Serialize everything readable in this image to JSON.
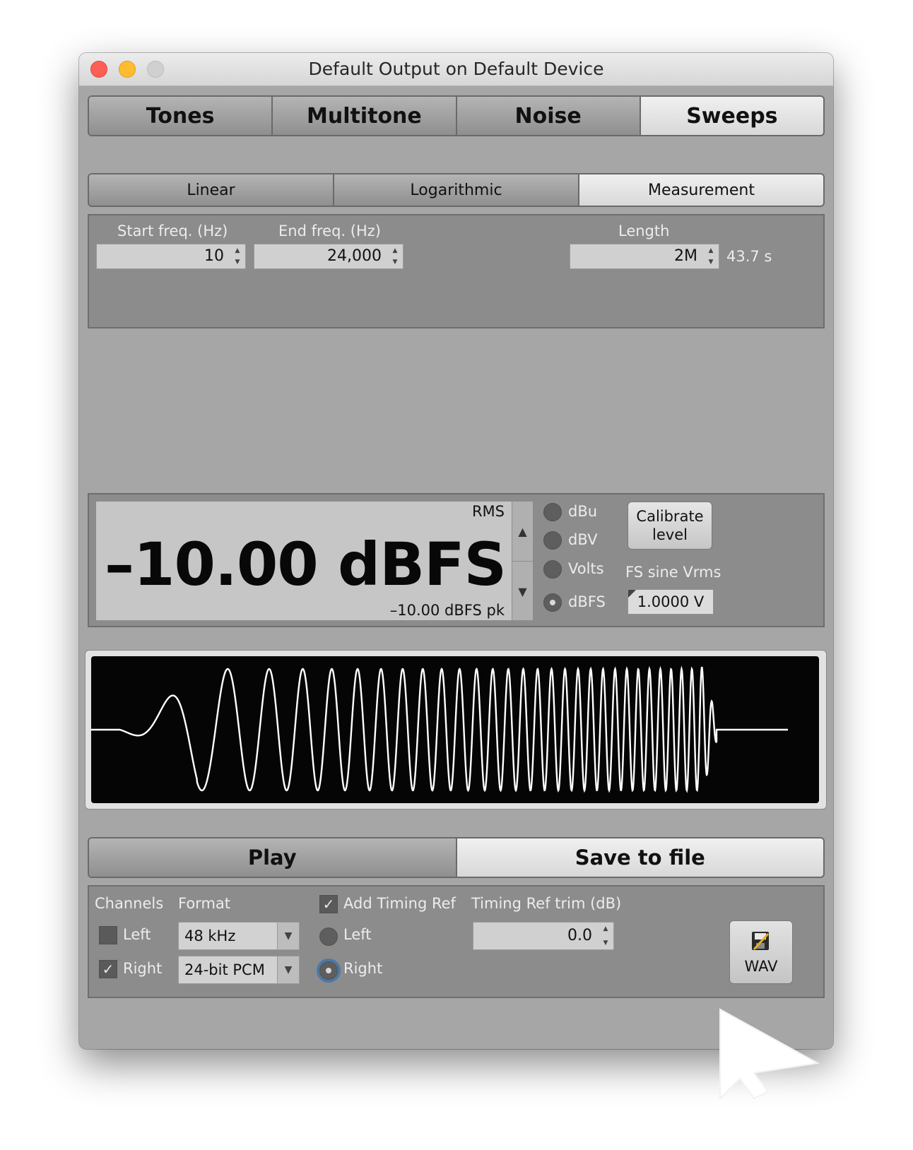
{
  "window": {
    "title": "Default Output on Default Device"
  },
  "main_tabs": [
    "Tones",
    "Multitone",
    "Noise",
    "Sweeps"
  ],
  "main_tab_active": "Sweeps",
  "sub_tabs": [
    "Linear",
    "Logarithmic",
    "Measurement"
  ],
  "sub_tab_active": "Measurement",
  "sweep": {
    "start_label": "Start freq. (Hz)",
    "start_value": "10",
    "end_label": "End freq. (Hz)",
    "end_value": "24,000",
    "length_label": "Length",
    "length_value": "2M",
    "length_seconds": "43.7 s"
  },
  "level": {
    "rms_label": "RMS",
    "value": "–10.00 dBFS",
    "peak": "–10.00 dBFS pk",
    "units": [
      "dBu",
      "dBV",
      "Volts",
      "dBFS"
    ],
    "unit_selected": "dBFS",
    "calibrate_line1": "Calibrate",
    "calibrate_line2": "level",
    "fs_label": "FS sine Vrms",
    "fs_value": "1.0000 V"
  },
  "bottom_tabs": [
    "Play",
    "Save to file"
  ],
  "bottom_tab_active": "Save to file",
  "save_options": {
    "channels_label": "Channels",
    "channels": [
      {
        "label": "Left",
        "checked": false
      },
      {
        "label": "Right",
        "checked": true
      }
    ],
    "format_label": "Format",
    "sample_rate": "48 kHz",
    "bit_depth": "24-bit PCM",
    "timing_ref_label": "Add Timing Ref",
    "timing_ref_checked": true,
    "timing_ref_channels": [
      {
        "label": "Left",
        "selected": false
      },
      {
        "label": "Right",
        "selected": true
      }
    ],
    "trim_label": "Timing Ref trim (dB)",
    "trim_value": "0.0",
    "wav_label": "WAV"
  },
  "colors": {
    "window_bg": "#a6a6a6",
    "panel_bg": "#8c8c8c",
    "scope_bg": "#050505",
    "trace": "#ffffff"
  },
  "icons": [
    "close-button",
    "minimize-button",
    "zoom-button",
    "spinner-arrows-icon",
    "dropdown-arrow-icon",
    "wav-file-icon",
    "cursor-arrow"
  ]
}
